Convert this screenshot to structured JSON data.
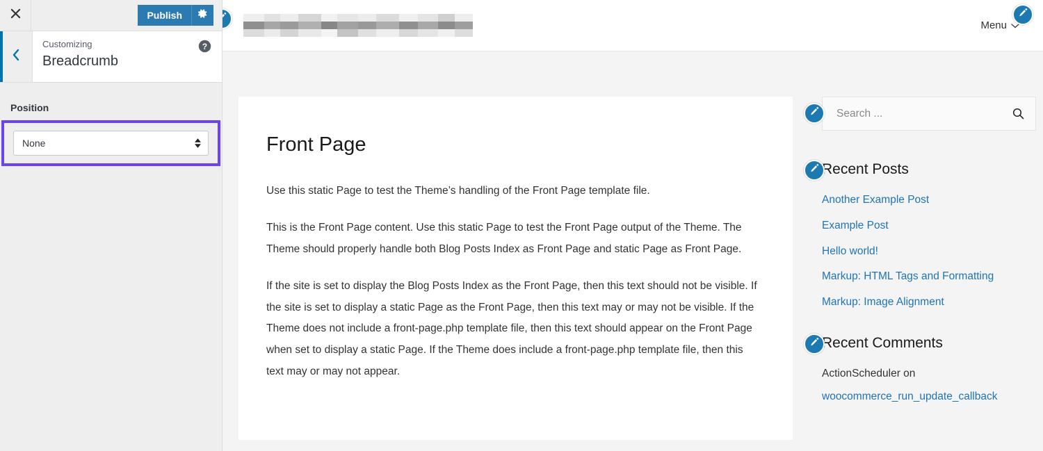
{
  "customizer": {
    "close_label": "Close",
    "close_icon": "close-icon",
    "publish_label": "Publish",
    "gear_icon": "gear-icon",
    "back_icon": "chevron-left-icon",
    "help_icon": "help-circle-icon",
    "customizing_label": "Customizing",
    "panel_title": "Breadcrumb",
    "control": {
      "label": "Position",
      "selected_value": "None",
      "options": [
        "None"
      ],
      "highlight_color": "#6b43f0"
    },
    "accent_color": "#0073aa",
    "publish_color": "#2b7bb0"
  },
  "preview": {
    "header": {
      "site_title_blurred": true,
      "menu_label": "Menu",
      "menu_caret_icon": "chevron-down-icon",
      "edit_icon": "pencil-edit-icon"
    },
    "content": {
      "heading": "Front Page",
      "paragraphs": [
        "Use this static Page to test the Theme’s handling of the Front Page template file.",
        "This is the Front Page content. Use this static Page to test the Front Page output of the Theme. The Theme should properly handle both Blog Posts Index as Front Page and static Page as Front Page.",
        "If the site is set to display the Blog Posts Index as the Front Page, then this text should not be visible. If the site is set to display a static Page as the Front Page, then this text may or may not be visible. If the Theme does not include a front-page.php template file, then this text should appear on the Front Page when set to display a static Page. If the Theme does include a front-page.php template file, then this text may or may not appear."
      ]
    },
    "sidebar": {
      "search": {
        "placeholder": "Search ...",
        "value": "",
        "icon": "search-icon"
      },
      "recent_posts": {
        "title": "Recent Posts",
        "items": [
          "Another Example Post",
          "Example Post",
          "Hello world!",
          "Markup: HTML Tags and Formatting",
          "Markup: Image Alignment"
        ]
      },
      "recent_comments": {
        "title": "Recent Comments",
        "author": "ActionScheduler on",
        "link": "woocommerce_run_update_callback"
      },
      "link_color": "#1f73b7",
      "edit_icon": "pencil-edit-icon"
    }
  }
}
